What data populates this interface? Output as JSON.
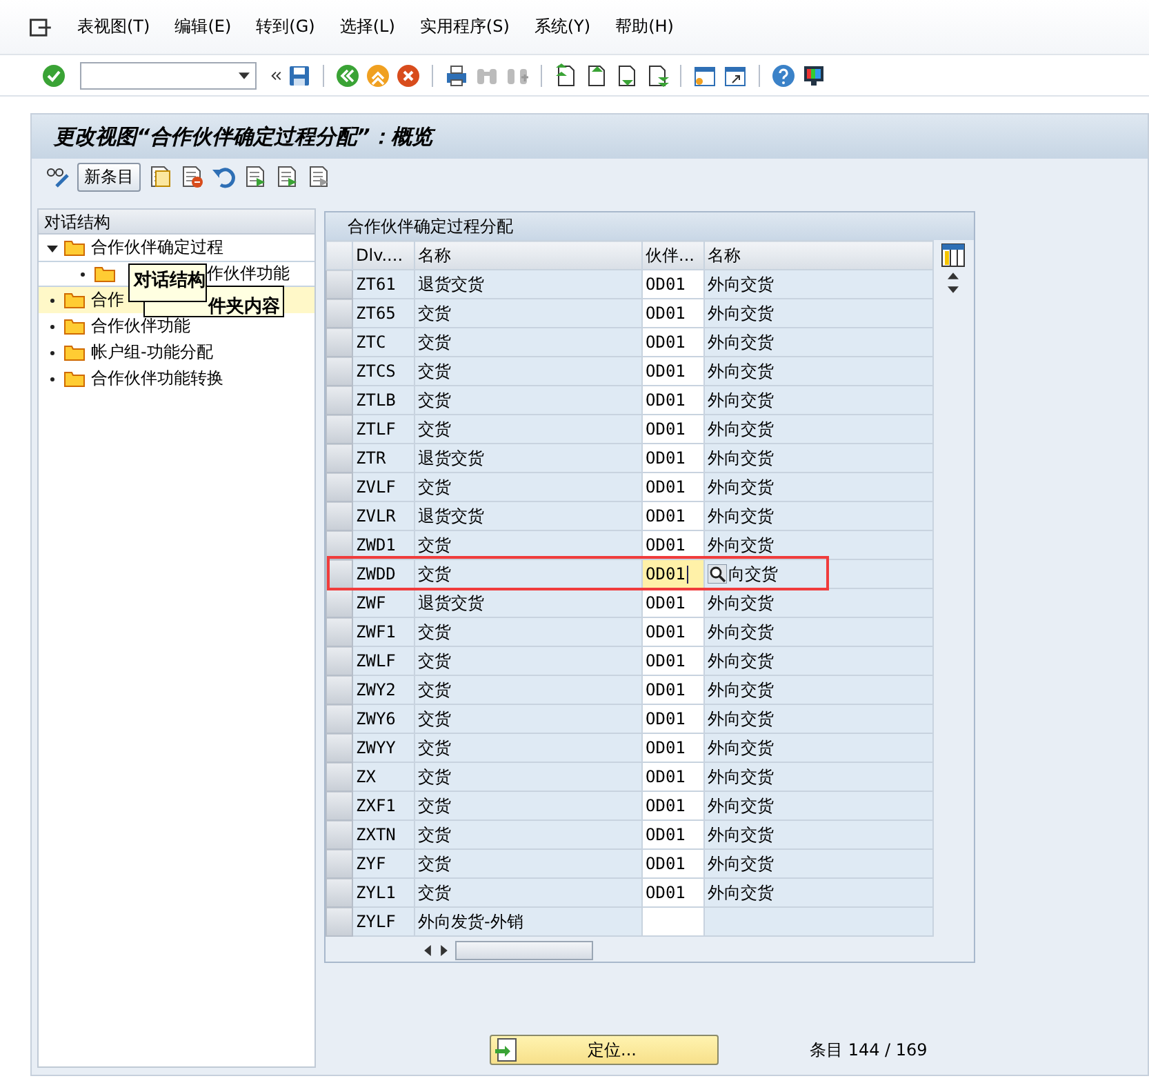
{
  "menu": [
    {
      "label": "表视图(T)"
    },
    {
      "label": "编辑(E)"
    },
    {
      "label": "转到(G)"
    },
    {
      "label": "选择(L)"
    },
    {
      "label": "实用程序(S)"
    },
    {
      "label": "系统(Y)"
    },
    {
      "label": "帮助(H)"
    }
  ],
  "title": "更改视图“合作伙伴确定过程分配”：概览",
  "app_toolbar": {
    "new_entries": "新条目"
  },
  "tree": {
    "heading": "对话结构",
    "items": [
      {
        "label": "合作伙伴确定过程",
        "expanded": true,
        "selected": false,
        "children": [
          {
            "label": "作伙伴功能",
            "selected": false
          }
        ]
      },
      {
        "label": "合作",
        "selected": true
      },
      {
        "label": "合作伙伴功能",
        "selected": false
      },
      {
        "label": "帐户组-功能分配",
        "selected": false
      },
      {
        "label": "合作伙伴功能转换",
        "selected": false
      }
    ]
  },
  "tooltips": [
    {
      "text": "件夹内容"
    },
    {
      "text": "对话结构"
    }
  ],
  "table": {
    "title": "合作伙伴确定过程分配",
    "columns": [
      "Dlv....",
      "名称",
      "伙伴...",
      "名称"
    ],
    "rows": [
      {
        "cells": [
          "ZT61",
          "退货交货",
          "OD01",
          "外向交货"
        ],
        "focused": false,
        "marked": false
      },
      {
        "cells": [
          "ZT65",
          "交货",
          "OD01",
          "外向交货"
        ],
        "focused": false,
        "marked": false
      },
      {
        "cells": [
          "ZTC",
          "交货",
          "OD01",
          "外向交货"
        ],
        "focused": false,
        "marked": false
      },
      {
        "cells": [
          "ZTCS",
          "交货",
          "OD01",
          "外向交货"
        ],
        "focused": false,
        "marked": false
      },
      {
        "cells": [
          "ZTLB",
          "交货",
          "OD01",
          "外向交货"
        ],
        "focused": false,
        "marked": false
      },
      {
        "cells": [
          "ZTLF",
          "交货",
          "OD01",
          "外向交货"
        ],
        "focused": false,
        "marked": false
      },
      {
        "cells": [
          "ZTR",
          "退货交货",
          "OD01",
          "外向交货"
        ],
        "focused": false,
        "marked": false
      },
      {
        "cells": [
          "ZVLF",
          "交货",
          "OD01",
          "外向交货"
        ],
        "focused": false,
        "marked": false
      },
      {
        "cells": [
          "ZVLR",
          "退货交货",
          "OD01",
          "外向交货"
        ],
        "focused": false,
        "marked": false
      },
      {
        "cells": [
          "ZWD1",
          "交货",
          "OD01",
          "外向交货"
        ],
        "focused": false,
        "marked": false
      },
      {
        "cells": [
          "ZWDD",
          "交货",
          "OD01",
          "向交货"
        ],
        "focused": true,
        "marked": true
      },
      {
        "cells": [
          "ZWF",
          "退货交货",
          "OD01",
          "外向交货"
        ],
        "focused": false,
        "marked": false
      },
      {
        "cells": [
          "ZWF1",
          "交货",
          "OD01",
          "外向交货"
        ],
        "focused": false,
        "marked": false
      },
      {
        "cells": [
          "ZWLF",
          "交货",
          "OD01",
          "外向交货"
        ],
        "focused": false,
        "marked": false
      },
      {
        "cells": [
          "ZWY2",
          "交货",
          "OD01",
          "外向交货"
        ],
        "focused": false,
        "marked": false
      },
      {
        "cells": [
          "ZWY6",
          "交货",
          "OD01",
          "外向交货"
        ],
        "focused": false,
        "marked": false
      },
      {
        "cells": [
          "ZWYY",
          "交货",
          "OD01",
          "外向交货"
        ],
        "focused": false,
        "marked": false
      },
      {
        "cells": [
          "ZX",
          "交货",
          "OD01",
          "外向交货"
        ],
        "focused": false,
        "marked": false
      },
      {
        "cells": [
          "ZXF1",
          "交货",
          "OD01",
          "外向交货"
        ],
        "focused": false,
        "marked": false
      },
      {
        "cells": [
          "ZXTN",
          "交货",
          "OD01",
          "外向交货"
        ],
        "focused": false,
        "marked": false
      },
      {
        "cells": [
          "ZYF",
          "交货",
          "OD01",
          "外向交货"
        ],
        "focused": false,
        "marked": false
      },
      {
        "cells": [
          "ZYL1",
          "交货",
          "OD01",
          "外向交货"
        ],
        "focused": false,
        "marked": false
      },
      {
        "cells": [
          "ZYLF",
          "外向发货-外销"
        ],
        "focused": false,
        "marked": false
      }
    ]
  },
  "position_button": "定位...",
  "entry_count": "条目 144 / 169"
}
